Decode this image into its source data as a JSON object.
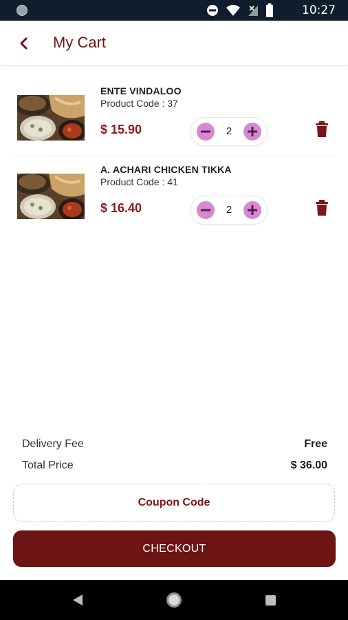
{
  "status_bar": {
    "time": "10:27",
    "icons": [
      "notification-dot-icon",
      "do-not-disturb-icon",
      "wifi-icon",
      "no-signal-icon",
      "battery-icon"
    ]
  },
  "app_bar": {
    "title": "My Cart",
    "back_icon": "chevron-left-icon"
  },
  "cart": {
    "items": [
      {
        "name": "ENTE VINDALOO",
        "product_code_label": "Product Code : 37",
        "price": "$ 15.90",
        "quantity": "2"
      },
      {
        "name": "A. ACHARI CHICKEN TIKKA",
        "product_code_label": "Product Code : 41",
        "price": "$ 16.40",
        "quantity": "2"
      }
    ]
  },
  "summary": {
    "delivery_fee_label": "Delivery Fee",
    "delivery_fee_value": "Free",
    "total_price_label": "Total Price",
    "total_price_value": "$ 36.00"
  },
  "actions": {
    "coupon_label": "Coupon Code",
    "checkout_label": "CHECKOUT"
  },
  "colors": {
    "primary": "#6d1414",
    "accent_price": "#8b1c1c",
    "qty_button": "#d48ad0",
    "status_bar": "#0f1d2c"
  }
}
